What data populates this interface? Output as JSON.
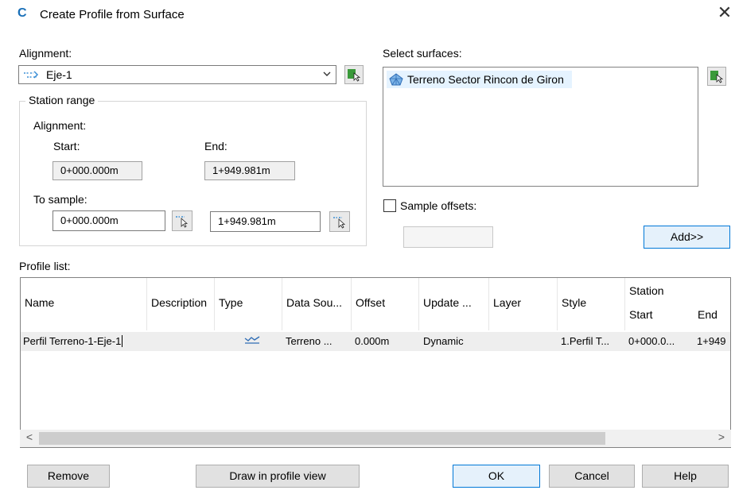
{
  "window": {
    "title": "Create Profile from Surface",
    "close_glyph": "✕",
    "app_logo_glyph": "C"
  },
  "alignment": {
    "label": "Alignment:",
    "value": "Eje-1"
  },
  "station_range": {
    "group_label": "Station range",
    "alignment_label": "Alignment:",
    "start_label": "Start:",
    "start_value": "0+000.000m",
    "end_label": "End:",
    "end_value": "1+949.981m",
    "to_sample_label": "To sample:",
    "sample_start": "0+000.000m",
    "sample_end": "1+949.981m"
  },
  "surfaces": {
    "label": "Select surfaces:",
    "items": [
      "Terreno Sector Rincon de Giron"
    ]
  },
  "sample_offsets": {
    "label": "Sample offsets:",
    "checked": false,
    "value": ""
  },
  "add_button": "Add>>",
  "profile_list": {
    "label": "Profile list:",
    "columns": {
      "name": "Name",
      "description": "Description",
      "type": "Type",
      "data_source": "Data Sou...",
      "offset": "Offset",
      "update_mode": "Update ...",
      "layer": "Layer",
      "style": "Style",
      "station": "Station",
      "station_start": "Start",
      "station_end": "End"
    },
    "rows": [
      {
        "name": "Perfil Terreno-1-Eje-1",
        "description": "",
        "type_icon": "surface-profile-icon",
        "data_source": "Terreno ...",
        "offset": "0.000m",
        "update_mode": "Dynamic",
        "layer": "",
        "style": "1.Perfil T...",
        "station_start": "0+000.0...",
        "station_end": "1+949"
      }
    ]
  },
  "buttons": {
    "remove": "Remove",
    "draw": "Draw in profile view",
    "ok": "OK",
    "cancel": "Cancel",
    "help": "Help"
  },
  "scrollbar": {
    "left_arrow": "<",
    "right_arrow": ">"
  },
  "colors": {
    "accent": "#0078d7",
    "selection": "#e5f3ff",
    "row_highlight": "#eeeeee",
    "pick_green": "#3a9a3a"
  }
}
